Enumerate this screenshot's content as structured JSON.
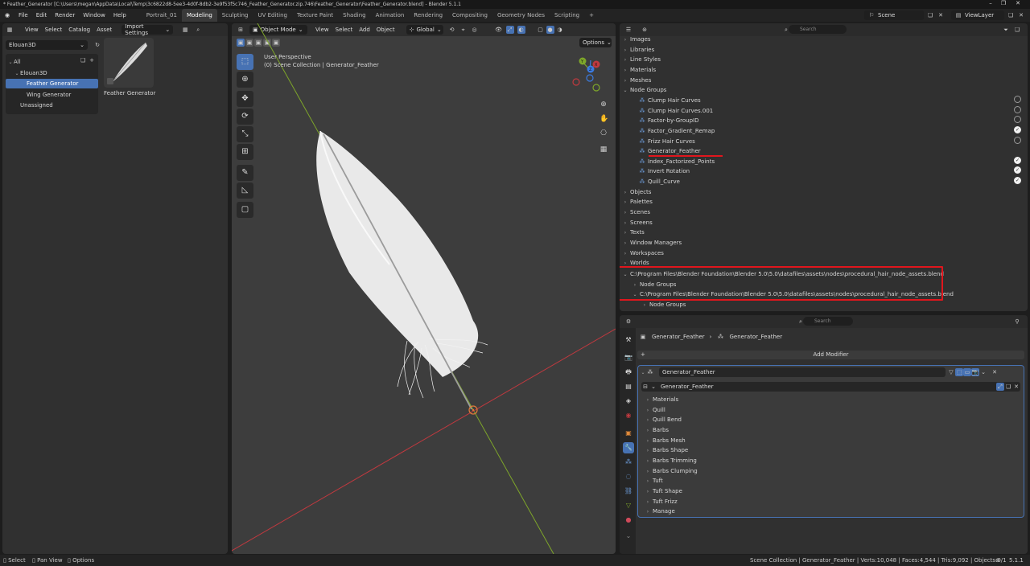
{
  "window": {
    "title": "* Feather_Generator [C:\\Users\\megan\\AppData\\Local\\Temp\\3c6822d8-5ee3-4d0f-8db2-3e9f53f5c746_Feather_Generator.zip.746\\Feather_Generator\\Feather_Generator.blend] - Blender 5.1.1",
    "controls": [
      "–",
      "❐",
      "✕"
    ]
  },
  "menu": [
    "File",
    "Edit",
    "Render",
    "Window",
    "Help"
  ],
  "workspaces": [
    "Portrait_01",
    "Modeling",
    "Sculpting",
    "UV Editing",
    "Texture Paint",
    "Shading",
    "Animation",
    "Rendering",
    "Compositing",
    "Geometry Nodes",
    "Scripting",
    "+"
  ],
  "active_workspace": "Modeling",
  "scene": {
    "label": "Scene",
    "view_layer": "ViewLayer"
  },
  "asset_browser": {
    "menu": [
      "View",
      "Select",
      "Catalog",
      "Asset"
    ],
    "import_settings": "Import Settings",
    "library": "Elouan3D",
    "tree": [
      {
        "label": "All",
        "indent": 0,
        "arrow": "⌄"
      },
      {
        "label": "Elouan3D",
        "indent": 1,
        "arrow": "⌄"
      },
      {
        "label": "Feather Generator",
        "indent": 2,
        "arrow": "",
        "selected": true
      },
      {
        "label": "Wing Generator",
        "indent": 2,
        "arrow": ""
      },
      {
        "label": "Unassigned",
        "indent": 1,
        "arrow": ""
      }
    ],
    "asset_name": "Feather Generator"
  },
  "viewport": {
    "mode": "Object Mode",
    "menu": [
      "View",
      "Select",
      "Add",
      "Object"
    ],
    "orientation": "Global",
    "options": "Options",
    "perspective": "User Perspective",
    "collection": "(0) Scene Collection | Generator_Feather",
    "gizmo": {
      "x": "X",
      "y": "Y",
      "z": "Z"
    }
  },
  "outliner": {
    "search_placeholder": "Search",
    "rows": [
      {
        "label": "Images",
        "indent": 0,
        "arrow": "›"
      },
      {
        "label": "Libraries",
        "indent": 0,
        "arrow": "›"
      },
      {
        "label": "Line Styles",
        "indent": 0,
        "arrow": "›"
      },
      {
        "label": "Materials",
        "indent": 0,
        "arrow": "›"
      },
      {
        "label": "Meshes",
        "indent": 0,
        "arrow": "›"
      },
      {
        "label": "Node Groups",
        "indent": 0,
        "arrow": "⌄"
      },
      {
        "label": "Clump Hair Curves",
        "indent": 1,
        "arrow": "",
        "chk": "off"
      },
      {
        "label": "Clump Hair Curves.001",
        "indent": 1,
        "arrow": "",
        "chk": "off"
      },
      {
        "label": "Factor-by-GroupID",
        "indent": 1,
        "arrow": "",
        "chk": "off"
      },
      {
        "label": "Factor_Gradient_Remap",
        "indent": 1,
        "arrow": "",
        "chk": "on"
      },
      {
        "label": "Frizz Hair Curves",
        "indent": 1,
        "arrow": "",
        "chk": "off"
      },
      {
        "label": "Generator_Feather",
        "indent": 1,
        "arrow": "",
        "chk": "",
        "underline": true
      },
      {
        "label": "Index_Factorized_Points",
        "indent": 1,
        "arrow": "",
        "chk": "on"
      },
      {
        "label": "Invert Rotation",
        "indent": 1,
        "arrow": "",
        "chk": "on"
      },
      {
        "label": "Quill_Curve",
        "indent": 1,
        "arrow": "",
        "chk": "on"
      },
      {
        "label": "Objects",
        "indent": 0,
        "arrow": "›"
      },
      {
        "label": "Palettes",
        "indent": 0,
        "arrow": "›"
      },
      {
        "label": "Scenes",
        "indent": 0,
        "arrow": "›"
      },
      {
        "label": "Screens",
        "indent": 0,
        "arrow": "›"
      },
      {
        "label": "Texts",
        "indent": 0,
        "arrow": "›"
      },
      {
        "label": "Window Managers",
        "indent": 0,
        "arrow": "›"
      },
      {
        "label": "Workspaces",
        "indent": 0,
        "arrow": "›"
      },
      {
        "label": "Worlds",
        "indent": 0,
        "arrow": "›"
      }
    ],
    "linked": [
      {
        "label": "C:\\Program Files\\Blender Foundation\\Blender 5.0\\5.0\\datafiles\\assets\\nodes\\procedural_hair_node_assets.blend",
        "indent": 0,
        "arrow": "⌄"
      },
      {
        "label": "Node Groups",
        "indent": 1,
        "arrow": "›"
      },
      {
        "label": "C:\\Program Files\\Blender Foundation\\Blender 5.0\\5.0\\datafiles\\assets\\nodes\\procedural_hair_node_assets.blend",
        "indent": 1,
        "arrow": "⌄"
      },
      {
        "label": "Node Groups",
        "indent": 2,
        "arrow": "›"
      }
    ],
    "highlight_color": "#e0161d"
  },
  "properties": {
    "search_placeholder": "Search",
    "breadcrumb": [
      "Generator_Feather",
      "Generator_Feather"
    ],
    "add_modifier": "Add Modifier",
    "modifier_name": "Generator_Feather",
    "node_group": "Generator_Feather",
    "panels": [
      "Materials",
      "Quill",
      "Quill Bend",
      "Barbs",
      "Barbs Mesh",
      "Barbs Shape",
      "Barbs Trimming",
      "Barbs Clumping",
      "Tuft",
      "Tuft Shape",
      "Tuft Frizz",
      "Manage"
    ]
  },
  "status": {
    "left": [
      "Select",
      "Pan View",
      "Options"
    ],
    "right": "Scene Collection | Generator_Feather | Verts:10,048 | Faces:4,544 | Tris:9,092 | Objects:0/1",
    "version": "5.1.1"
  },
  "colors": {
    "accent": "#4772b3",
    "x_axis": "#c0393f",
    "y_axis": "#7ea62a",
    "z_axis": "#3b7be0"
  }
}
